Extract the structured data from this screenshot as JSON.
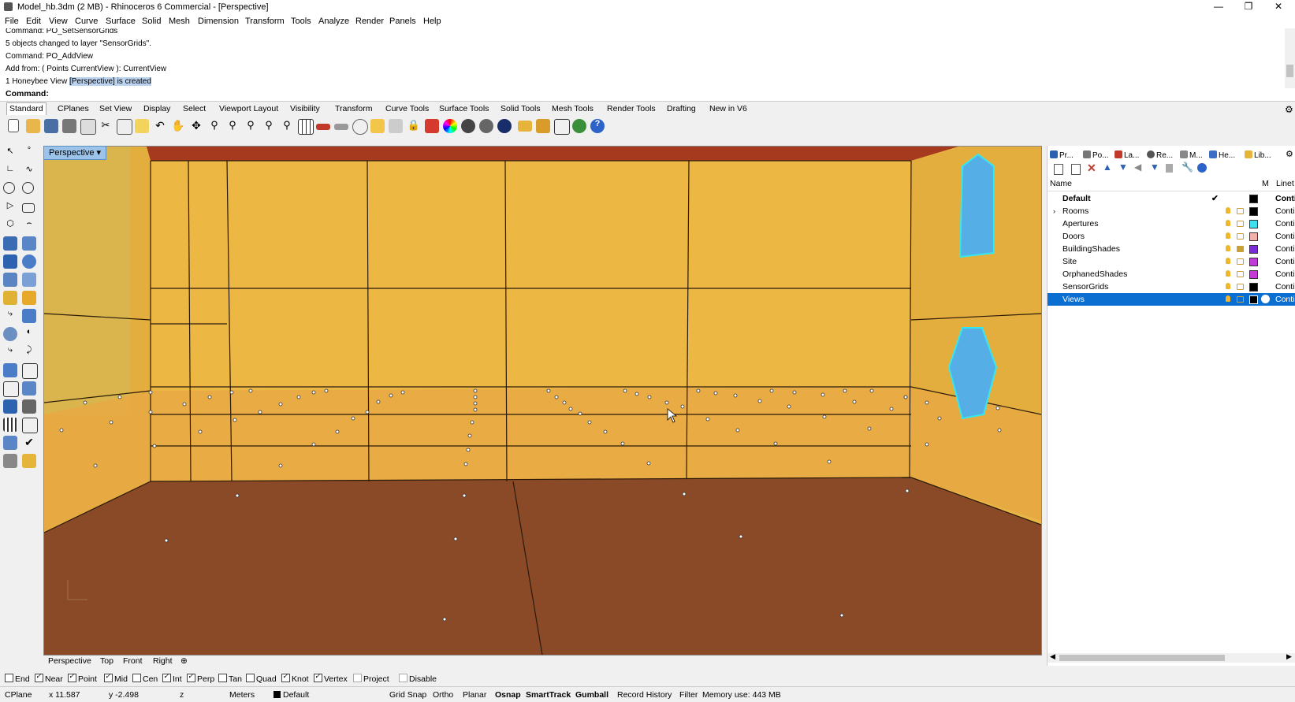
{
  "window": {
    "title": "Model_hb.3dm (2 MB) - Rhinoceros 6 Commercial - [Perspective]"
  },
  "menu": [
    "File",
    "Edit",
    "View",
    "Curve",
    "Surface",
    "Solid",
    "Mesh",
    "Dimension",
    "Transform",
    "Tools",
    "Analyze",
    "Render",
    "Panels",
    "Help"
  ],
  "command": {
    "history": [
      "Command: PO_SetSensorGrids",
      "5 objects changed to layer \"SensorGrids\".",
      "Command: PO_AddView",
      "Add from: ( Points  CurrentView ): CurrentView"
    ],
    "last_prefix": "1 Honeybee View ",
    "last_highlight": "[Perspective] is created",
    "prompt_label": "Command:"
  },
  "toolbar_tabs": [
    "Standard",
    "CPlanes",
    "Set View",
    "Display",
    "Select",
    "Viewport Layout",
    "Visibility",
    "Transform",
    "Curve Tools",
    "Surface Tools",
    "Solid Tools",
    "Mesh Tools",
    "Render Tools",
    "Drafting",
    "New in V6"
  ],
  "viewport": {
    "name": "Perspective",
    "tabs": [
      "Perspective",
      "Top",
      "Front",
      "Right"
    ]
  },
  "panel": {
    "tabs": [
      "Pr...",
      "Po...",
      "La...",
      "Re...",
      "M...",
      "He...",
      "Lib..."
    ],
    "columns": {
      "name": "Name",
      "material": "M",
      "linetype": "Linet"
    },
    "layers": [
      {
        "name": "Default",
        "color": "#000000",
        "linetype": "Conti",
        "current": true
      },
      {
        "name": "Rooms",
        "color": "#000000",
        "linetype": "Conti",
        "expand": true
      },
      {
        "name": "Apertures",
        "color": "#3ee0f0",
        "linetype": "Conti"
      },
      {
        "name": "Doors",
        "color": "#f2b0a8",
        "linetype": "Conti"
      },
      {
        "name": "BuildingShades",
        "color": "#7a2bd6",
        "linetype": "Conti"
      },
      {
        "name": "Site",
        "color": "#c03ad8",
        "linetype": "Conti"
      },
      {
        "name": "OrphanedShades",
        "color": "#c43ad6",
        "linetype": "Conti"
      },
      {
        "name": "SensorGrids",
        "color": "#000000",
        "linetype": "Conti"
      },
      {
        "name": "Views",
        "color": "#000000",
        "linetype": "Conti",
        "selected": true
      }
    ]
  },
  "osnap": [
    {
      "label": "End",
      "on": false
    },
    {
      "label": "Near",
      "on": true
    },
    {
      "label": "Point",
      "on": true
    },
    {
      "label": "Mid",
      "on": true
    },
    {
      "label": "Cen",
      "on": false
    },
    {
      "label": "Int",
      "on": true
    },
    {
      "label": "Perp",
      "on": true
    },
    {
      "label": "Tan",
      "on": false
    },
    {
      "label": "Quad",
      "on": false
    },
    {
      "label": "Knot",
      "on": true
    },
    {
      "label": "Vertex",
      "on": true
    },
    {
      "label": "Project",
      "on": false
    },
    {
      "label": "Disable",
      "on": false
    }
  ],
  "status": {
    "cplane": "CPlane",
    "x": "x 11.587",
    "y": "y -2.498",
    "z": "z",
    "units": "Meters",
    "layer": "Default",
    "toggles": [
      "Grid Snap",
      "Ortho",
      "Planar",
      "Osnap",
      "SmartTrack",
      "Gumball",
      "Record History",
      "Filter"
    ],
    "memory": "Memory use: 443 MB"
  }
}
